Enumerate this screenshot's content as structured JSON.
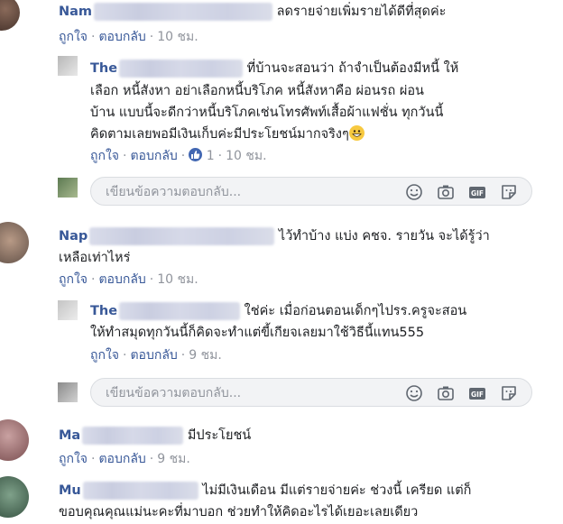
{
  "comments": [
    {
      "name_visible": "Nam",
      "text_lines": [
        "ลดรายจ่ายเพิ่มรายได้ดีที่สุดค่ะ"
      ],
      "actions": {
        "like": "ถูกใจ",
        "reply": "ตอบกลับ",
        "time": "10 ชม."
      }
    },
    {
      "name_visible": "The",
      "text_lines": [
        "ที่บ้านจะสอนว่า ถ้าจำเป็นต้องมีหนี้ ให้",
        "เลือก หนี้สังหา อย่าเลือกหนี้บริโภค หนี้สังหาคือ ผ่อนรถ ผ่อน",
        "บ้าน แบบนี้จะดีกว่าหนี้บริโภคเช่นโทรศัพท์เสื้อผ้าแฟชั่น ทุกวันนี้",
        "คิดตามเลยพอมีเงินเก็บค่ะมีประโยชน์มากจริงๆ"
      ],
      "actions": {
        "like": "ถูกใจ",
        "reply": "ตอบกลับ",
        "reaction_count": "1",
        "time": "10 ชม."
      }
    },
    {
      "name_visible": "Nap",
      "text_lines": [
        "ไว้ทำบ้าง แบ่ง คชจ. รายวัน จะได้รู้ว่า",
        "เหลือเท่าไหร่"
      ],
      "actions": {
        "like": "ถูกใจ",
        "reply": "ตอบกลับ",
        "time": "10 ชม."
      }
    },
    {
      "name_visible": "The",
      "text_lines": [
        "ใช่ค่ะ เมื่อก่อนตอนเด็กๆไปรร.ครูจะสอน",
        "ให้ทำสมุดทุกวันนี้ก็คิดจะทำแต่ขี้เกียจเลยมาใช้วิธีนี้แทน555"
      ],
      "actions": {
        "like": "ถูกใจ",
        "reply": "ตอบกลับ",
        "time": "9 ชม."
      }
    },
    {
      "name_visible": "Ma",
      "text_lines": [
        "มีประโยชน์"
      ],
      "actions": {
        "like": "ถูกใจ",
        "reply": "ตอบกลับ",
        "time": "9 ชม."
      }
    },
    {
      "name_visible": "Mu",
      "text_lines": [
        "ไม่มีเงินเดือน มีแต่รายจ่ายค่ะ ช่วงนี้ เครียด แต่ก็",
        "ขอบคุณคุณแม่นะคะที่มาบอก ช่วยทำให้คิดอะไรได้เยอะเลยเดียว"
      ]
    }
  ],
  "reply_box": {
    "placeholder": "เขียนข้อความตอบกลับ..."
  },
  "separator": "·",
  "icons": [
    "smiley-icon",
    "camera-icon",
    "gif-icon",
    "sticker-icon",
    "thumbs-up-icon",
    "grinning-emoji-icon"
  ],
  "colors": {
    "link": "#385898",
    "meta": "#90949c",
    "like_badge": "#4267b2",
    "reply_bg": "#f2f3f5"
  }
}
